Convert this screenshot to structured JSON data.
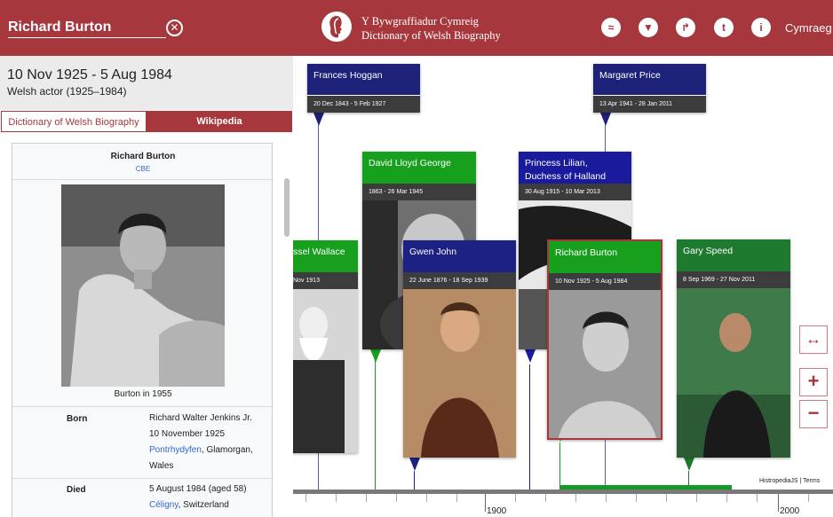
{
  "header": {
    "search_value": "Richard Burton",
    "brand_line1": "Y Bywgraffiadur Cymreig",
    "brand_line2": "Dictionary of Welsh Biography",
    "language_link": "Cymraeg",
    "icons": [
      "swimmer-icon",
      "filter-icon",
      "share-icon",
      "twitter-icon",
      "info-icon"
    ],
    "accent_color": "#a5373d"
  },
  "left_panel": {
    "dates": "10 Nov 1925 - 5 Aug 1984",
    "description": "Welsh actor (1925–1984)",
    "tabs": [
      "Dictionary of Welsh Biography",
      "Wikipedia"
    ],
    "active_tab": "Wikipedia",
    "infobox": {
      "name": "Richard Burton",
      "honorific": "CBE",
      "caption": "Burton in 1955",
      "born_label": "Born",
      "born_lines": [
        "Richard Walter Jenkins Jr.",
        "10 November 1925"
      ],
      "born_place_link": "Pontrhydyfen",
      "born_place_rest": ", Glamorgan,",
      "born_country": "Wales",
      "died_label": "Died",
      "died_line": "5 August 1984 (aged 58)",
      "died_place_link": "Céligny",
      "died_place_rest": ", Switzerland"
    }
  },
  "timeline": {
    "cards": [
      {
        "name": "Frances Hoggan",
        "dates": "20 Dec 1843 - 5 Feb 1927",
        "color": "#1d2178"
      },
      {
        "name": "Margaret Price",
        "dates": "13 Apr 1941 - 28 Jan 2011",
        "color": "#1d2178"
      },
      {
        "name": "David Lloyd George",
        "dates": "1863 - 26 Mar 1945",
        "color": "#16a01e"
      },
      {
        "name": "Princess Lilian, Duchess of Halland",
        "dates": "30 Aug 1915 - 10 Mar 2013",
        "color": "#1a1a9c"
      },
      {
        "name": "ssel Wallace",
        "dates": "Nov 1913",
        "color": "#16a01e"
      },
      {
        "name": "Gwen John",
        "dates": "22 June 1876 - 18 Sep 1939",
        "color": "#1d2183"
      },
      {
        "name": "Richard Burton",
        "dates": "10 Nov 1925 - 5 Aug 1984",
        "color": "#16a01e"
      },
      {
        "name": "Gary Speed",
        "dates": "8 Sep 1969 - 27 Nov 2011",
        "color": "#1e7a2e"
      }
    ],
    "credit": "HistropediaJS | Terms",
    "axis_years": [
      "1900",
      "2000"
    ],
    "controls": [
      "expand-horizontal",
      "zoom-in",
      "zoom-out"
    ]
  }
}
